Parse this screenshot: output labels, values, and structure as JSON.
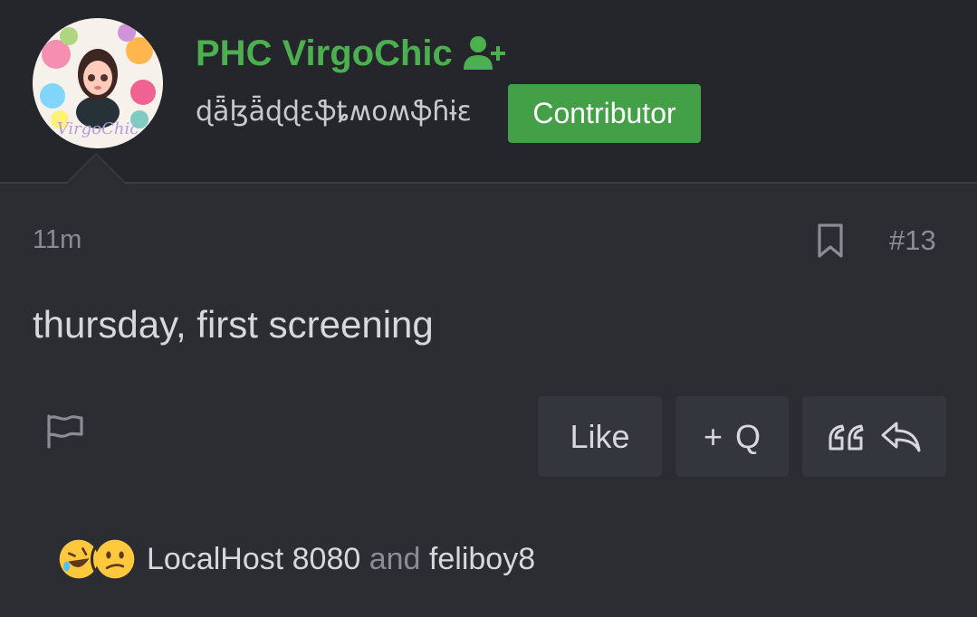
{
  "post": {
    "author": {
      "name": "PHC VirgoChic",
      "avatar_text": "VirgoChic",
      "custom_title": "ɖǟɮǟɖɖɛֆȶʍօʍֆɦɨɛ",
      "badge": "Contributor"
    },
    "time": "11m",
    "number": "#13",
    "content": "thursday, first screening"
  },
  "actions": {
    "like_label": "Like",
    "multiquote_plus": "+",
    "multiquote_label": "Q"
  },
  "reactions": {
    "emojis": [
      "rolling-on-floor-laughing",
      "confused-face"
    ],
    "user1": "LocalHost 8080",
    "conj": "and",
    "user2": "feliboy8"
  },
  "colors": {
    "accent_green": "#4caf50",
    "badge_green": "#43a047",
    "background": "#2b2d33",
    "header_background": "#24262b"
  }
}
